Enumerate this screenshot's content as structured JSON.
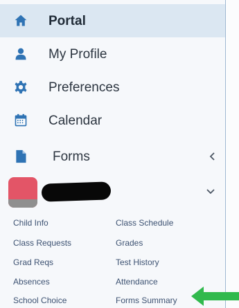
{
  "nav": {
    "portal": "Portal",
    "my_profile": "My Profile",
    "preferences": "Preferences",
    "calendar": "Calendar",
    "forms": "Forms"
  },
  "student_links": {
    "child_info": "Child Info",
    "class_schedule": "Class Schedule",
    "class_requests": "Class Requests",
    "grades": "Grades",
    "grad_reqs": "Grad Reqs",
    "test_history": "Test History",
    "absences": "Absences",
    "attendance": "Attendance",
    "school_choice": "School Choice",
    "forms_summary": "Forms Summary"
  },
  "colors": {
    "accent": "#2f73b4",
    "active_bg": "#dbe7f2",
    "link": "#3d5272",
    "arrow": "#31b94d"
  }
}
